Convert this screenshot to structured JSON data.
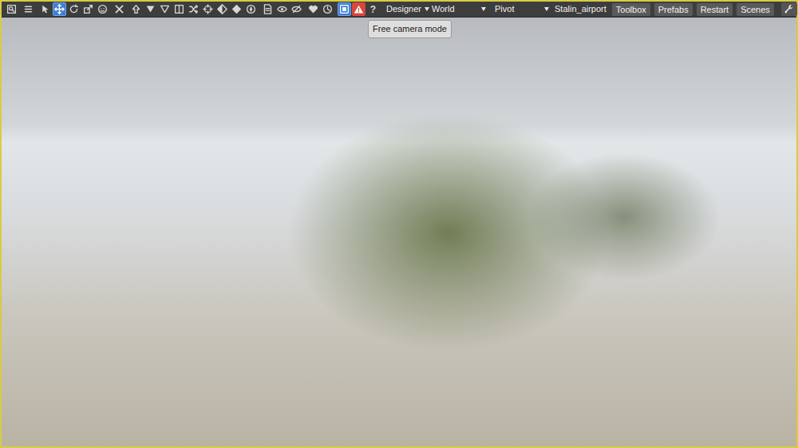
{
  "toolbar": {
    "tool_groups": [
      [
        {
          "kind": "search",
          "selected": false
        }
      ],
      [
        {
          "kind": "list",
          "selected": false
        }
      ],
      [
        {
          "kind": "select",
          "selected": false
        },
        {
          "kind": "move",
          "selected": true
        },
        {
          "kind": "rotate",
          "selected": false
        },
        {
          "kind": "scale",
          "selected": false
        },
        {
          "kind": "face",
          "selected": false
        }
      ],
      [
        {
          "kind": "cross",
          "selected": false
        }
      ],
      [
        {
          "kind": "up",
          "selected": false
        },
        {
          "kind": "down-solid",
          "selected": false
        },
        {
          "kind": "down-outline",
          "selected": false
        },
        {
          "kind": "split",
          "selected": false
        },
        {
          "kind": "shuffle",
          "selected": false
        },
        {
          "kind": "target",
          "selected": false
        },
        {
          "kind": "diamond-half",
          "selected": false
        },
        {
          "kind": "diamond",
          "selected": false
        },
        {
          "kind": "compass",
          "selected": false
        }
      ],
      [
        {
          "kind": "page",
          "selected": false
        },
        {
          "kind": "eye",
          "selected": false
        },
        {
          "kind": "eye-slash",
          "selected": false
        }
      ],
      [
        {
          "kind": "heart",
          "selected": false
        },
        {
          "kind": "clock",
          "selected": false
        }
      ],
      [
        {
          "kind": "camera",
          "selected": true
        },
        {
          "kind": "warning",
          "selected": false
        },
        {
          "kind": "help",
          "selected": false,
          "label": "?"
        }
      ]
    ],
    "dropdowns": [
      {
        "label": "Designer"
      },
      {
        "label": "World"
      },
      {
        "label": "Pivot"
      }
    ],
    "scene": "Stalin_airport",
    "buttons": [
      "Toolbox",
      "Prefabs",
      "Restart",
      "Scenes"
    ],
    "icon_buttons": [
      {
        "kind": "wrench"
      },
      {
        "kind": "close"
      }
    ]
  },
  "tooltip": {
    "text": "Free camera mode"
  }
}
